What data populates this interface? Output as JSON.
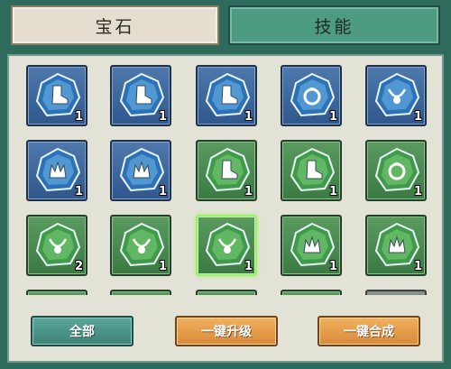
{
  "tabs": [
    {
      "label": "宝石",
      "active": true
    },
    {
      "label": "技能",
      "active": false
    }
  ],
  "colors": {
    "blue_frame": "#3a6399",
    "green_frame": "#4a8a50",
    "selected_border": "#9bf06a",
    "orange_button": "#e59b47",
    "teal_button": "#4b9588"
  },
  "gems": [
    {
      "frame": "blue",
      "icon": "boot-gem-icon",
      "count": "1"
    },
    {
      "frame": "blue",
      "icon": "boot-gem-icon",
      "count": "1"
    },
    {
      "frame": "blue",
      "icon": "boot-gem-icon",
      "count": "1"
    },
    {
      "frame": "blue",
      "icon": "ring-gem-icon",
      "count": "1"
    },
    {
      "frame": "blue",
      "icon": "necklace-gem-icon",
      "count": "1"
    },
    {
      "frame": "blue",
      "icon": "crown-gem-icon",
      "count": "1"
    },
    {
      "frame": "blue",
      "icon": "crown-gem-icon",
      "count": "1"
    },
    {
      "frame": "green",
      "icon": "boot-gem-icon",
      "count": "1"
    },
    {
      "frame": "green",
      "icon": "boot-gem-icon",
      "count": "1"
    },
    {
      "frame": "green",
      "icon": "ring-gem-icon",
      "count": "1"
    },
    {
      "frame": "green",
      "icon": "necklace-gem-icon",
      "count": "2"
    },
    {
      "frame": "green",
      "icon": "necklace-gem-icon",
      "count": "1"
    },
    {
      "frame": "green",
      "icon": "necklace-gem-icon",
      "count": "1",
      "selected": true
    },
    {
      "frame": "green",
      "icon": "crown-gem-icon",
      "count": "1"
    },
    {
      "frame": "green",
      "icon": "crown-gem-icon",
      "count": "1"
    },
    {
      "frame": "green",
      "icon": "gem-icon",
      "count": ""
    },
    {
      "frame": "green",
      "icon": "gem-icon",
      "count": ""
    },
    {
      "frame": "green",
      "icon": "gem-icon",
      "count": ""
    },
    {
      "frame": "green",
      "icon": "gem-icon",
      "count": ""
    },
    {
      "frame": "grey",
      "icon": "gem-icon",
      "count": ""
    }
  ],
  "buttons": {
    "all": "全部",
    "upgrade_all": "一键升级",
    "merge_all": "一键合成"
  }
}
